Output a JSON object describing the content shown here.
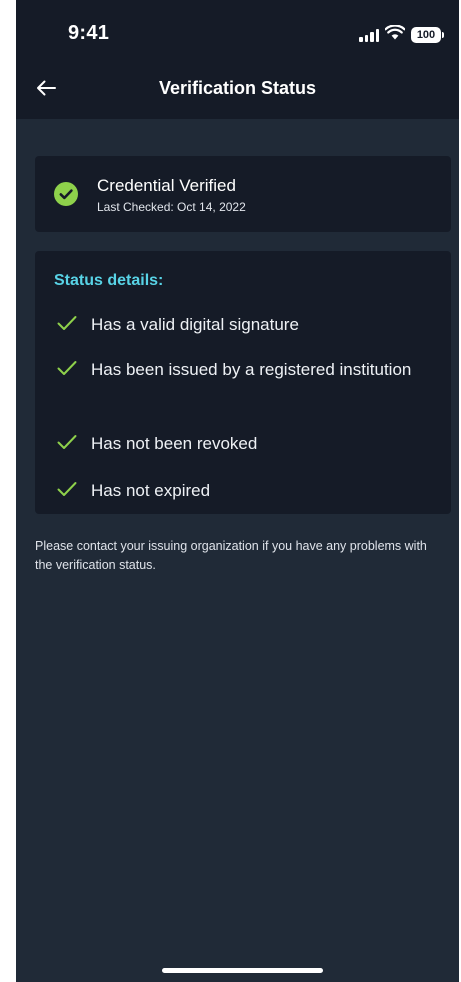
{
  "status_bar": {
    "time": "9:41",
    "battery": "100",
    "icons": [
      "signal-icon",
      "wifi-icon",
      "battery-icon"
    ]
  },
  "header": {
    "title": "Verification Status",
    "back_icon": "arrow-left-icon"
  },
  "verified_card": {
    "title": "Credential Verified",
    "subtitle": "Last Checked: Oct 14, 2022",
    "icon": "check-circle-icon"
  },
  "details": {
    "heading": "Status details:",
    "items": [
      "Has a valid digital signature",
      "Has been issued by a registered institution",
      "Has not been revoked",
      "Has not expired"
    ]
  },
  "note": "Please contact your issuing organization if you have any problems with the verification status.",
  "colors": {
    "background": "#202a37",
    "card": "#151b27",
    "success": "#8ed14b",
    "heading": "#58d3e6"
  }
}
